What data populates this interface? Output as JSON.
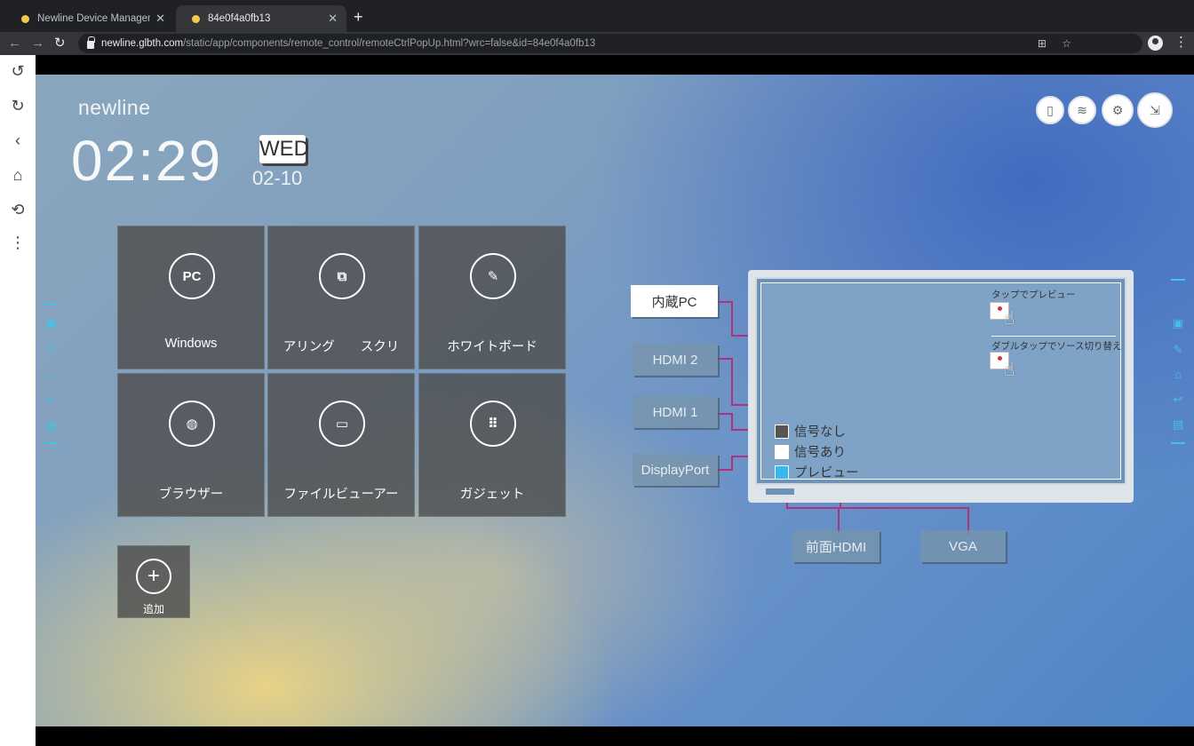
{
  "browser": {
    "tabs": [
      {
        "title": "Newline Device Management",
        "active": false
      },
      {
        "title": "84e0f4a0fb13",
        "active": true
      }
    ],
    "url_host": "newline.glbth.com",
    "url_path": "/static/app/components/remote_control/remoteCtrlPopUp.html?wrc=false&id=84e0f4a0fb13"
  },
  "left_toolbar": [
    "undo-icon",
    "redo-icon",
    "back-icon",
    "home-icon",
    "history-icon",
    "more-icon"
  ],
  "screen": {
    "brand": "newline",
    "time": "02:29",
    "day": "WED",
    "date": "02-10",
    "top_icons": [
      "usb-icon",
      "wireless-icon",
      "settings-icon",
      "input-source-icon"
    ],
    "tiles": [
      {
        "label": "Windows",
        "icon": "PC"
      },
      {
        "label": "アリング　　スクリ",
        "icon": "cast"
      },
      {
        "label": "ホワイトボード",
        "icon": "pen"
      },
      {
        "label": "ブラウザー",
        "icon": "globe"
      },
      {
        "label": "ファイルビューアー",
        "icon": "folder"
      },
      {
        "label": "ガジェット",
        "icon": "grid"
      }
    ],
    "add_label": "追加",
    "sources": {
      "internal_pc": "内蔵PC",
      "hdmi2": "HDMI 2",
      "hdmi1": "HDMI 1",
      "displayport": "DisplayPort",
      "front_hdmi": "前面HDMI",
      "vga": "VGA"
    },
    "legend": [
      {
        "label": "信号なし",
        "color": "#555555"
      },
      {
        "label": "信号あり",
        "color": "#ffffff"
      },
      {
        "label": "プレビュー",
        "color": "#36b9f0"
      }
    ],
    "hint_preview": "タップでプレビュー",
    "hint_switch": "ダブルタップでソース切り替え",
    "colors": {
      "accent_rail": "#46c0e6",
      "connector": "#b0327c"
    }
  }
}
